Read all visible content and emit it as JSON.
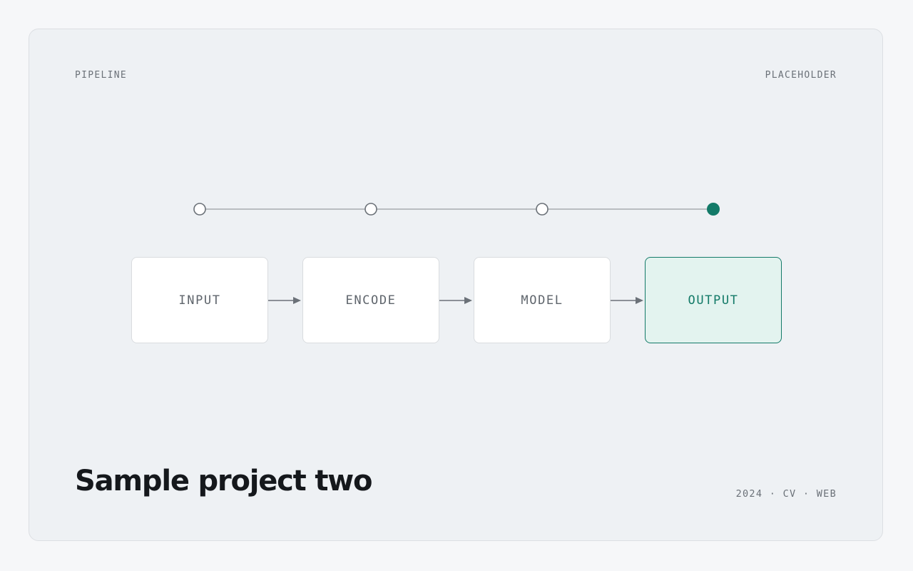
{
  "header": {
    "left_label": "PIPELINE",
    "right_label": "PLACEHOLDER"
  },
  "pipeline": {
    "stages": [
      {
        "label": "INPUT",
        "active": false
      },
      {
        "label": "ENCODE",
        "active": false
      },
      {
        "label": "MODEL",
        "active": false
      },
      {
        "label": "OUTPUT",
        "active": true
      }
    ],
    "active_index": 3
  },
  "footer": {
    "title": "Sample project two",
    "meta": "2024 · CV · WEB"
  },
  "colors": {
    "accent": "#137a68",
    "accent_fill": "#e3f3ef",
    "muted_text": "#6b7178",
    "line": "#b9bdc1",
    "arrow": "#6b7178",
    "card_bg": "#eef1f4"
  }
}
